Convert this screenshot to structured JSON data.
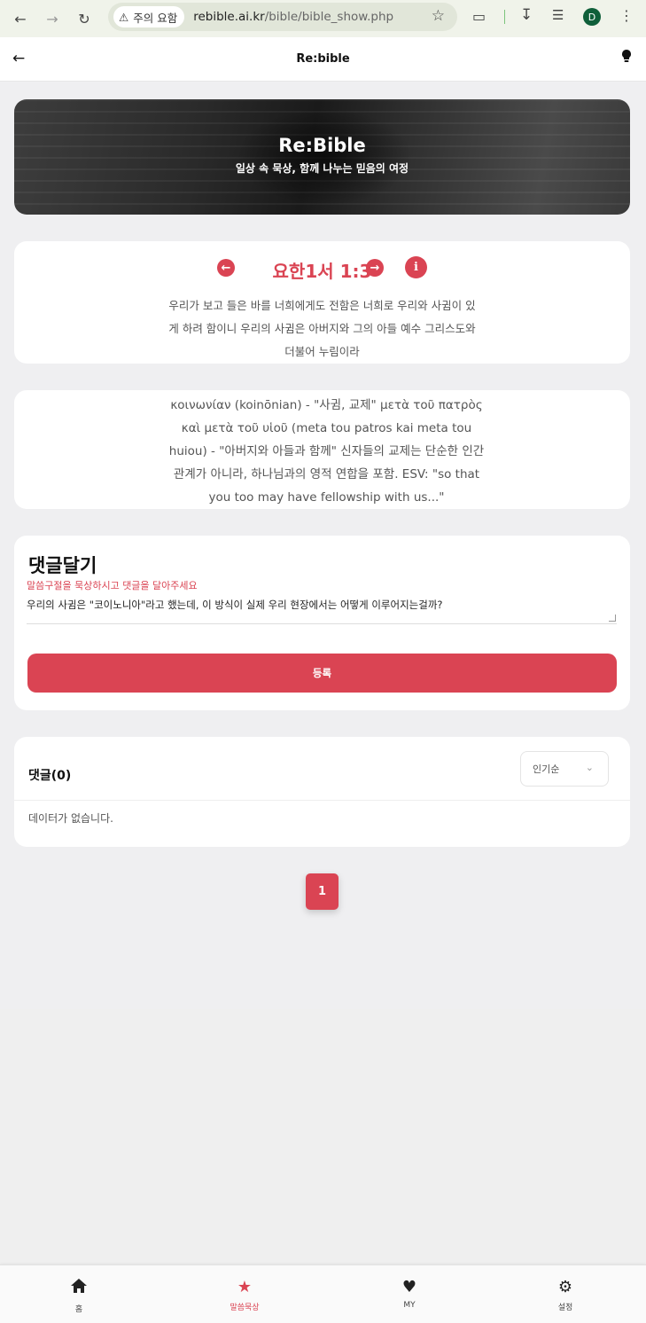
{
  "browser": {
    "security_label": "주의 요함",
    "url_host": "rebible.ai.kr",
    "url_path": "/bible/bible_show.php",
    "profile_initial": "D"
  },
  "header": {
    "title": "Re:bible"
  },
  "banner": {
    "title": "Re:Bible",
    "subtitle": "일상 속 묵상, 함께 나누는 믿음의 여정"
  },
  "verse": {
    "reference": "요한1서 1:3",
    "text": "우리가 보고 들은 바를 너희에게도 전함은 너희로 우리와 사귐이 있게 하려 함이니 우리의 사귐은 아버지와 그의 아들 예수 그리스도와 더불어 누림이라"
  },
  "commentary": {
    "text": "κοινωνίαν (koinōnian) - \"사귐, 교제\" μετὰ τοῦ πατρὸς καὶ μετὰ τοῦ υἱοῦ (meta tou patros kai meta tou huiou) - \"아버지와 아들과 함께\" 신자들의 교제는 단순한 인간 관계가 아니라, 하나님과의 영적 연합을 포함. ESV: \"so that you too may have fellowship with us...\""
  },
  "comment_form": {
    "title": "댓글달기",
    "hint": "말씀구절을 묵상하시고 댓글을 달아주세요",
    "input_value": "우리의 사귐은 \"코이노니아\"라고 했는데, 이 방식이 실제 우리 현장에서는 어떻게 이루어지는걸까?",
    "submit_label": "등록"
  },
  "comments": {
    "title": "댓글(0)",
    "sort_selected": "인기순",
    "empty_message": "데이터가 없습니다."
  },
  "pagination": {
    "current_page": "1"
  },
  "bottom_nav": {
    "items": [
      {
        "label": "홈",
        "icon": "home-icon"
      },
      {
        "label": "말씀묵상",
        "icon": "star-icon"
      },
      {
        "label": "MY",
        "icon": "heart-icon"
      },
      {
        "label": "설정",
        "icon": "gear-icon"
      }
    ],
    "active_index": 1
  },
  "colors": {
    "accent": "#da4453",
    "page_background": "#efeff1"
  }
}
